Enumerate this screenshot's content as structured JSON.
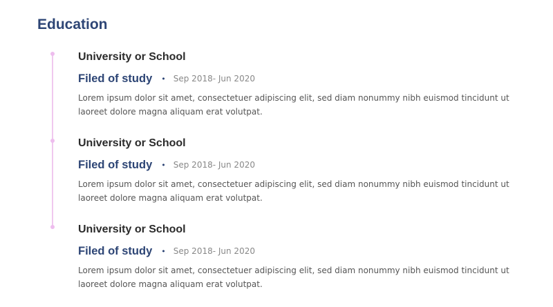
{
  "section": {
    "title": "Education"
  },
  "entries": [
    {
      "school": "University or School",
      "field": "Filed of study",
      "bullet": "•",
      "dates": "Sep 2018- Jun 2020",
      "description": "Lorem ipsum dolor sit amet, consectetuer adipiscing elit, sed diam nonummy nibh euismod tincidunt ut laoreet dolore magna aliquam erat volutpat."
    },
    {
      "school": "University or School",
      "field": "Filed of study",
      "bullet": "•",
      "dates": "Sep 2018- Jun 2020",
      "description": "Lorem ipsum dolor sit amet, consectetuer adipiscing elit, sed diam nonummy nibh euismod tincidunt ut laoreet dolore magna aliquam erat volutpat."
    },
    {
      "school": "University or School",
      "field": "Filed of study",
      "bullet": "•",
      "dates": "Sep 2018- Jun 2020",
      "description": "Lorem ipsum dolor sit amet, consectetuer adipiscing elit, sed diam nonummy nibh euismod tincidunt ut laoreet dolore magna aliquam erat volutpat."
    }
  ],
  "colors": {
    "heading": "#2d4575",
    "timeline": "#f0c8ef",
    "body_text": "#555555"
  }
}
